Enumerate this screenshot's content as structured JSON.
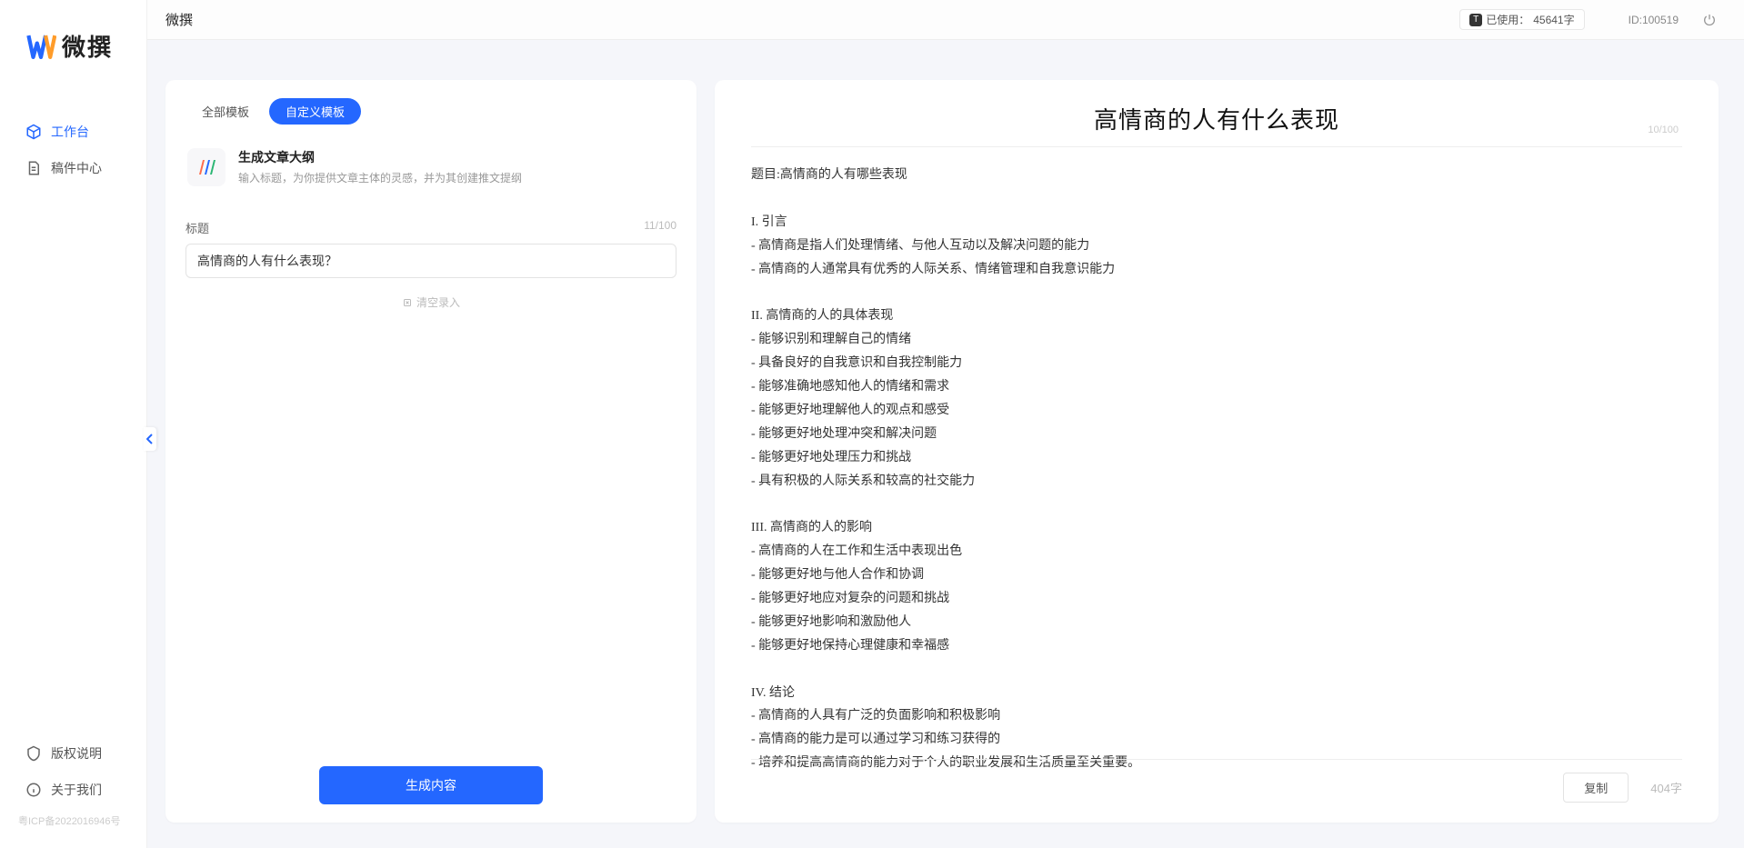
{
  "brand": {
    "name": "微撰"
  },
  "topbar": {
    "title": "微撰",
    "usage_prefix": "已使用：",
    "usage_value": "45641字",
    "id_label": "ID:100519"
  },
  "sidebar": {
    "items": [
      {
        "label": "工作台"
      },
      {
        "label": "稿件中心"
      }
    ],
    "bottom": [
      {
        "label": "版权说明"
      },
      {
        "label": "关于我们"
      }
    ],
    "icp": "粤ICP备2022016946号"
  },
  "tabs": {
    "all": "全部模板",
    "custom": "自定义模板"
  },
  "template": {
    "title": "生成文章大纲",
    "desc": "输入标题，为你提供文章主体的灵感，并为其创建推文提纲"
  },
  "field": {
    "label": "标题",
    "counter": "11/100",
    "value": "高情商的人有什么表现？",
    "clear": "清空录入"
  },
  "generate": "生成内容",
  "output": {
    "title": "高情商的人有什么表现",
    "title_counter": "10/100",
    "body": "题目:高情商的人有哪些表现\n\nI. 引言\n- 高情商是指人们处理情绪、与他人互动以及解决问题的能力\n- 高情商的人通常具有优秀的人际关系、情绪管理和自我意识能力\n\nII. 高情商的人的具体表现\n- 能够识别和理解自己的情绪\n- 具备良好的自我意识和自我控制能力\n- 能够准确地感知他人的情绪和需求\n- 能够更好地理解他人的观点和感受\n- 能够更好地处理冲突和解决问题\n- 能够更好地处理压力和挑战\n- 具有积极的人际关系和较高的社交能力\n\nIII. 高情商的人的影响\n- 高情商的人在工作和生活中表现出色\n- 能够更好地与他人合作和协调\n- 能够更好地应对复杂的问题和挑战\n- 能够更好地影响和激励他人\n- 能够更好地保持心理健康和幸福感\n\nIV. 结论\n- 高情商的人具有广泛的负面影响和积极影响\n- 高情商的能力是可以通过学习和练习获得的\n- 培养和提高高情商的能力对于个人的职业发展和生活质量至关重要。",
    "copy": "复制",
    "word_count": "404字"
  }
}
